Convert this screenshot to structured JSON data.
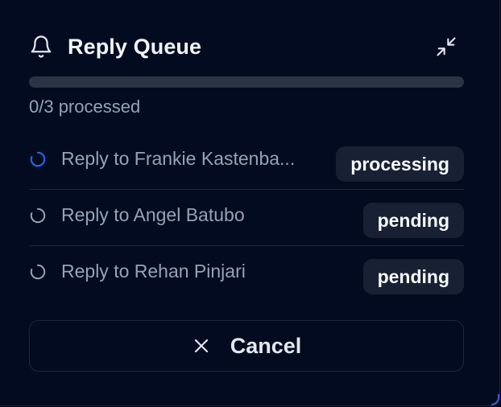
{
  "header": {
    "title": "Reply Queue",
    "icon": "bell-icon",
    "minimize_icon": "minimize-icon"
  },
  "progress": {
    "processed": 0,
    "total": 3,
    "fraction": 0,
    "text": "0/3 processed"
  },
  "queue": {
    "items": [
      {
        "label": "Reply to Frankie Kastenba...",
        "status": "processing",
        "icon": "spinner-icon"
      },
      {
        "label": "Reply to Angel Batubo",
        "status": "pending",
        "icon": "loading-circle-icon"
      },
      {
        "label": "Reply to Rehan Pinjari",
        "status": "pending",
        "icon": "loading-circle-icon"
      }
    ]
  },
  "actions": {
    "cancel_label": "Cancel",
    "cancel_icon": "close-icon"
  },
  "colors": {
    "background": "#020b1f",
    "accent_blue": "#2563eb",
    "muted_text": "#94a3b8",
    "badge_background": "#172133"
  }
}
